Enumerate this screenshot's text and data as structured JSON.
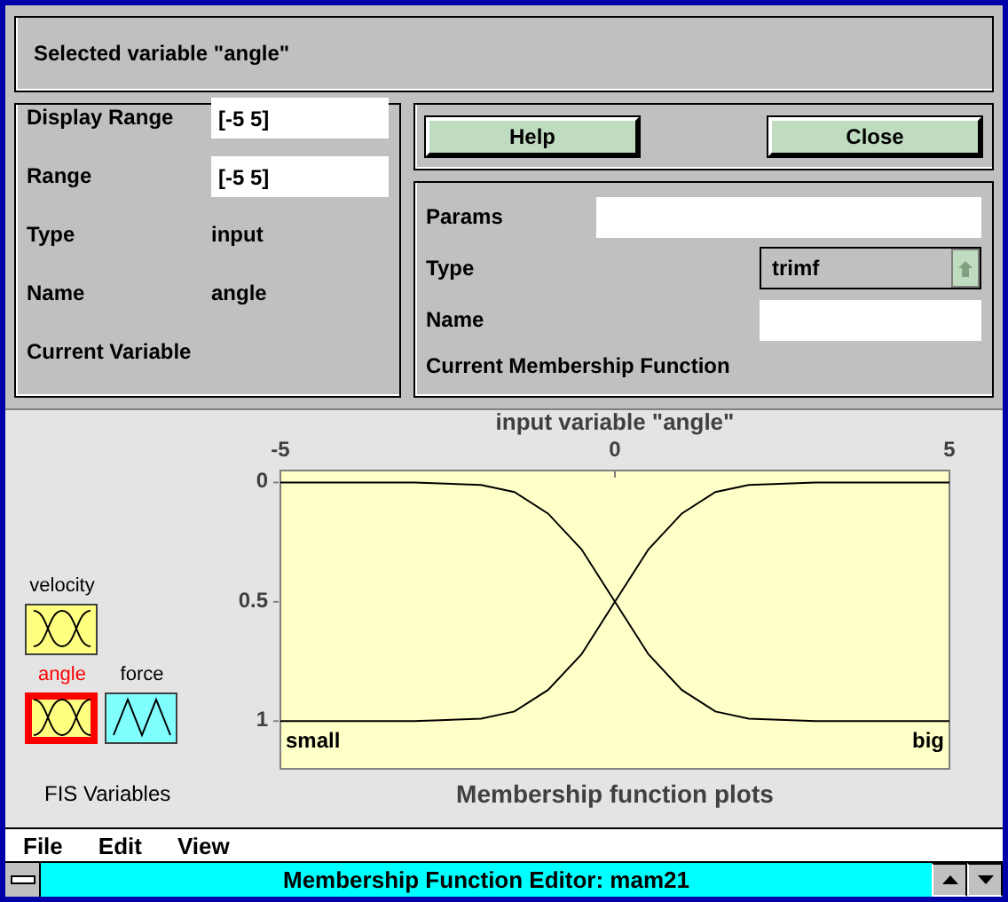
{
  "window": {
    "title": "Membership Function Editor: mam21"
  },
  "menu": [
    "File",
    "Edit",
    "View"
  ],
  "fis_panel": {
    "title": "FIS Variables",
    "variables": [
      {
        "name": "angle",
        "kind": "input",
        "selected": true
      },
      {
        "name": "velocity",
        "kind": "input",
        "selected": false
      },
      {
        "name": "force",
        "kind": "output",
        "selected": false
      }
    ]
  },
  "plot": {
    "chart_data": {
      "type": "line",
      "title": "Membership function plots",
      "xlabel": "input variable \"angle\"",
      "x": [
        -5,
        -4,
        -3,
        -2,
        -1.5,
        -1,
        -0.5,
        0,
        0.5,
        1,
        1.5,
        2,
        3,
        4,
        5
      ],
      "series": [
        {
          "name": "small",
          "color": "#000000",
          "values": [
            1,
            1,
            1,
            0.99,
            0.96,
            0.87,
            0.72,
            0.5,
            0.28,
            0.13,
            0.04,
            0.01,
            0,
            0,
            0
          ]
        },
        {
          "name": "big",
          "color": "#000000",
          "values": [
            0,
            0,
            0,
            0.01,
            0.04,
            0.13,
            0.28,
            0.5,
            0.72,
            0.87,
            0.96,
            0.99,
            1,
            1,
            1
          ]
        }
      ],
      "xlim": [
        -5,
        5
      ],
      "ylim": [
        1.2,
        -0.05
      ],
      "xticks": [
        -5,
        0,
        5
      ],
      "yticks": [
        0,
        0.5,
        1
      ]
    }
  },
  "current_variable": {
    "title": "Current Variable",
    "name_label": "Name",
    "name": "angle",
    "type_label": "Type",
    "type": "input",
    "range_label": "Range",
    "range": "[-5 5]",
    "display_range_label": "Display Range",
    "display_range": "[-5 5]"
  },
  "current_mf": {
    "title": "Current Membership Function",
    "name_label": "Name",
    "type_label": "Type",
    "type": "trimf",
    "params_label": "Params"
  },
  "buttons": [
    "Help",
    "Close"
  ],
  "status": "Selected variable \"angle\""
}
